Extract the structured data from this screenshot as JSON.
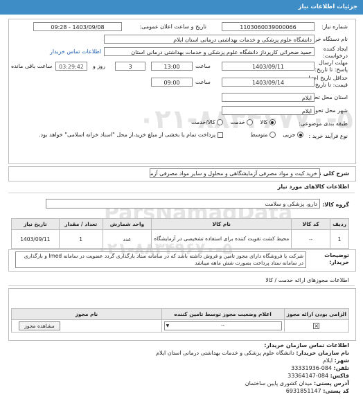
{
  "window": {
    "title": "جزئیات اطلاعات نیاز"
  },
  "watermark": {
    "top": "۰۲۱-۸۸۳۴۶۷۷۰-۵",
    "main": "ParsNamadData",
    "bottom": "۰۲۱-۸۸۳۴۹۶۷۰-۵"
  },
  "fields": {
    "need_number_label": "شماره نیاز:",
    "need_number_value": "1103060039000066",
    "announce_label": "تاریخ و ساعت اعلان عمومی:",
    "announce_value": "1403/09/08 - 09:28",
    "buyer_label": "نام دستگاه خریدار:",
    "buyer_value": "دانشگاه علوم پزشکی و خدمات بهداشتی درمانی استان ایلام",
    "requester_label": "ایجاد کننده درخواست:",
    "requester_value": "حمید صحرائی کارپرداز دانشگاه علوم پزشکی و خدمات بهداشتی درمانی استان",
    "contact_link": "اطلاعات تماس خریدار",
    "deadline_label": "مهلت ارسال پاسخ: تا تاریخ:",
    "deadline_date": "1403/09/11",
    "hour_label": "ساعت",
    "deadline_time": "13:00",
    "remaining_days": "3",
    "day_and_label": "روز و",
    "remaining_time": "03:29:42",
    "remaining_label": "ساعت باقی مانده",
    "validity_label": "حداقل تاریخ اعتبار قیمت: تا تاریخ:",
    "validity_date": "1403/09/14",
    "validity_time": "09:00",
    "province_label": "استان محل تحویل:",
    "province_value": "ایلام",
    "city_label": "شهر محل تحویل:",
    "city_value": "ایلام",
    "category_label": "طبقه بندی موضوعی:",
    "cat_goods": "کالا",
    "cat_service": "خدمت",
    "cat_goods_service": "کالا/خدمت",
    "process_label": "نوع فرآیند خرید :",
    "proc_minor": "جزیی",
    "proc_medium": "متوسط",
    "payment_note": "پرداخت تمام یا بخشی از مبلغ خرید،از محل \"اسناد خزانه اسلامی\" خواهد بود."
  },
  "description": {
    "label": "شرح کلی نیاز:",
    "value": "خرید کیت و مواد مصرفی آزمایشگاهی و محلول و سایر مواد مصرفی آزمایشگاهی"
  },
  "goods": {
    "section_title": "اطلاعات کالاهای مورد نیاز",
    "group_label": "گروه کالا:",
    "group_value": "دارو، پزشکی و سلامت",
    "headers": [
      "ردیف",
      "کد کالا",
      "نام کالا",
      "واحد شمارش",
      "تعداد / مقدار",
      "تاریخ نیاز"
    ],
    "rows": [
      {
        "row": "1",
        "code": "--",
        "name": "محیط کشت تقویت کننده برای استفاده تشخیصی در آزمایشگاه",
        "unit": "عدد",
        "qty": "1",
        "date": "1403/09/11"
      }
    ]
  },
  "notes": {
    "label": "توضیحات خریدار:",
    "text": "شرکت یا فروشگاه دارای مجوز تامین و فروش داشته باشد که در سامانه ستاد بارگذاری گردد عضویت در سامانه Imed و بارگذاری در سامانه ستاد پرداخت بصورت شش ماهه میباشد"
  },
  "permits": {
    "title": "اطلاعات مجوزهای ارائه خدمت / کالا",
    "headers": [
      "الزامی بودن ارائه مجوز",
      "اعلام وضعیت مجوز توسط تامین کننده",
      "نام مجوز"
    ],
    "rows": [
      {
        "status": "--",
        "view_button": "مشاهده مجوز"
      }
    ]
  },
  "contact": {
    "title": "اطلاعات تماس سازمان خریدار:",
    "org_label": "نام سازمان خریدار:",
    "org_value": "دانشگاه علوم پزشکی و خدمات بهداشتی درمانی استان ایلام",
    "city_label": "شهر:",
    "city_value": "ایلام",
    "phone_label": "تلفن:",
    "phone_value": "084-33331936",
    "fax_label": "فاکس:",
    "fax_value": "084-33364147",
    "address_label": "آدرس پستی:",
    "address_value": "میدان کشوری پایین ساختمان",
    "postal_label": "کد پستی:",
    "postal_value": "6931851147"
  },
  "colors": {
    "header": "#3f8dc6",
    "link": "#1b5fb3"
  }
}
